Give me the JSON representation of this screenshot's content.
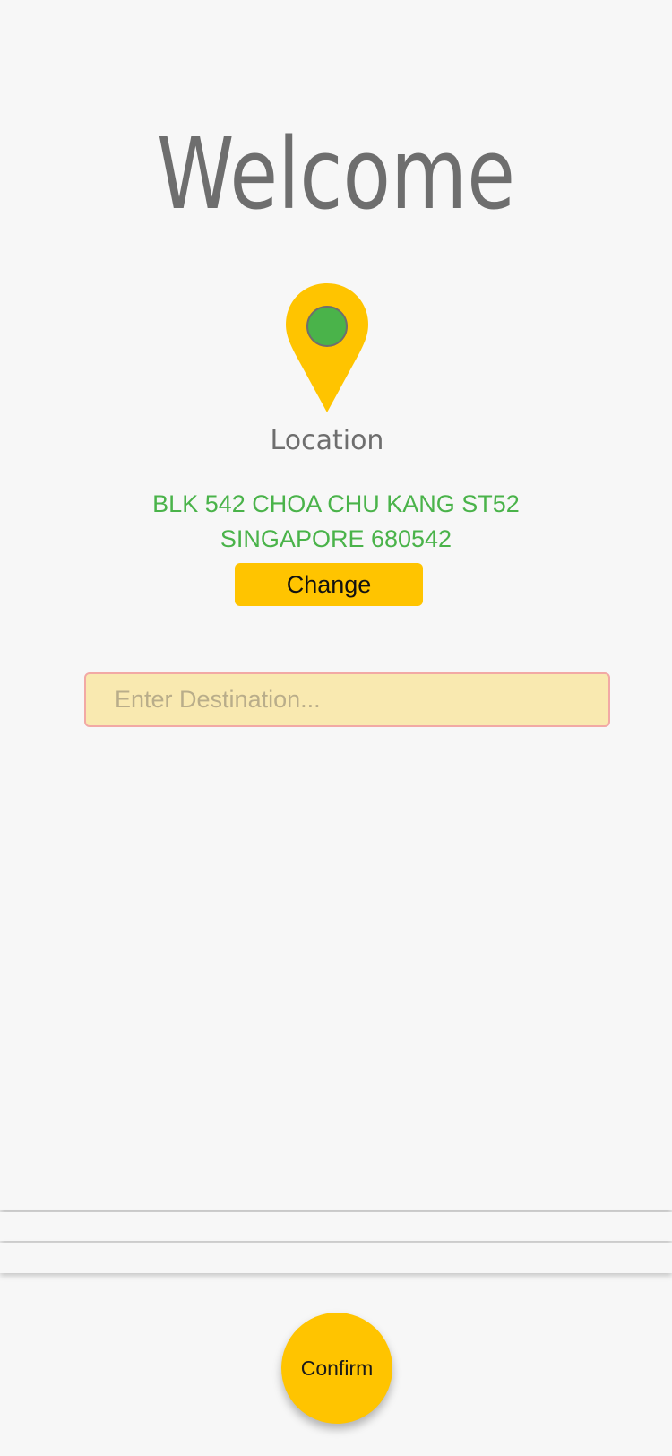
{
  "header": {
    "title": "Welcome"
  },
  "location": {
    "label": "Location",
    "address_line1": "BLK 542 CHOA CHU KANG ST52",
    "address_line2": "SINGAPORE 680542",
    "change_label": "Change",
    "pin_icon": "map-pin-icon"
  },
  "destination": {
    "placeholder": "Enter Destination...",
    "value": ""
  },
  "footer": {
    "confirm_label": "Confirm"
  },
  "colors": {
    "accent_yellow": "#ffc400",
    "address_green": "#4ab34a",
    "title_gray": "#6e6e6e",
    "input_bg": "#f9e9b0",
    "input_border": "#f2a9a5"
  }
}
